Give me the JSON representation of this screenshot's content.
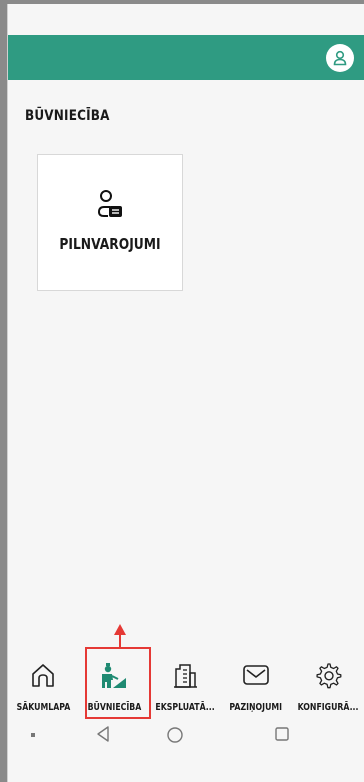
{
  "colors": {
    "app_bar": "#2f9b82",
    "accent_icon": "#1f8a72",
    "highlight": "#e53935"
  },
  "header": {
    "profile_icon": "user-icon"
  },
  "page": {
    "title": "BŪVNIECĪBA"
  },
  "cards": [
    {
      "icon": "user-card-icon",
      "label": "PILNVAROJUMI"
    }
  ],
  "bottom_nav": {
    "items": [
      {
        "icon": "home-icon",
        "label": "SĀKUMLAPA"
      },
      {
        "icon": "construction-worker-icon",
        "label": "BŪVNIECĪBA",
        "active": true
      },
      {
        "icon": "buildings-icon",
        "label": "EKSPLUATĀ..."
      },
      {
        "icon": "mail-icon",
        "label": "PAZIŅOJUMI"
      },
      {
        "icon": "gear-icon",
        "label": "KONFIGURĀ..."
      }
    ]
  },
  "system_nav": [
    "menu-dot-icon",
    "back-icon",
    "home-circle-icon",
    "recents-icon"
  ]
}
